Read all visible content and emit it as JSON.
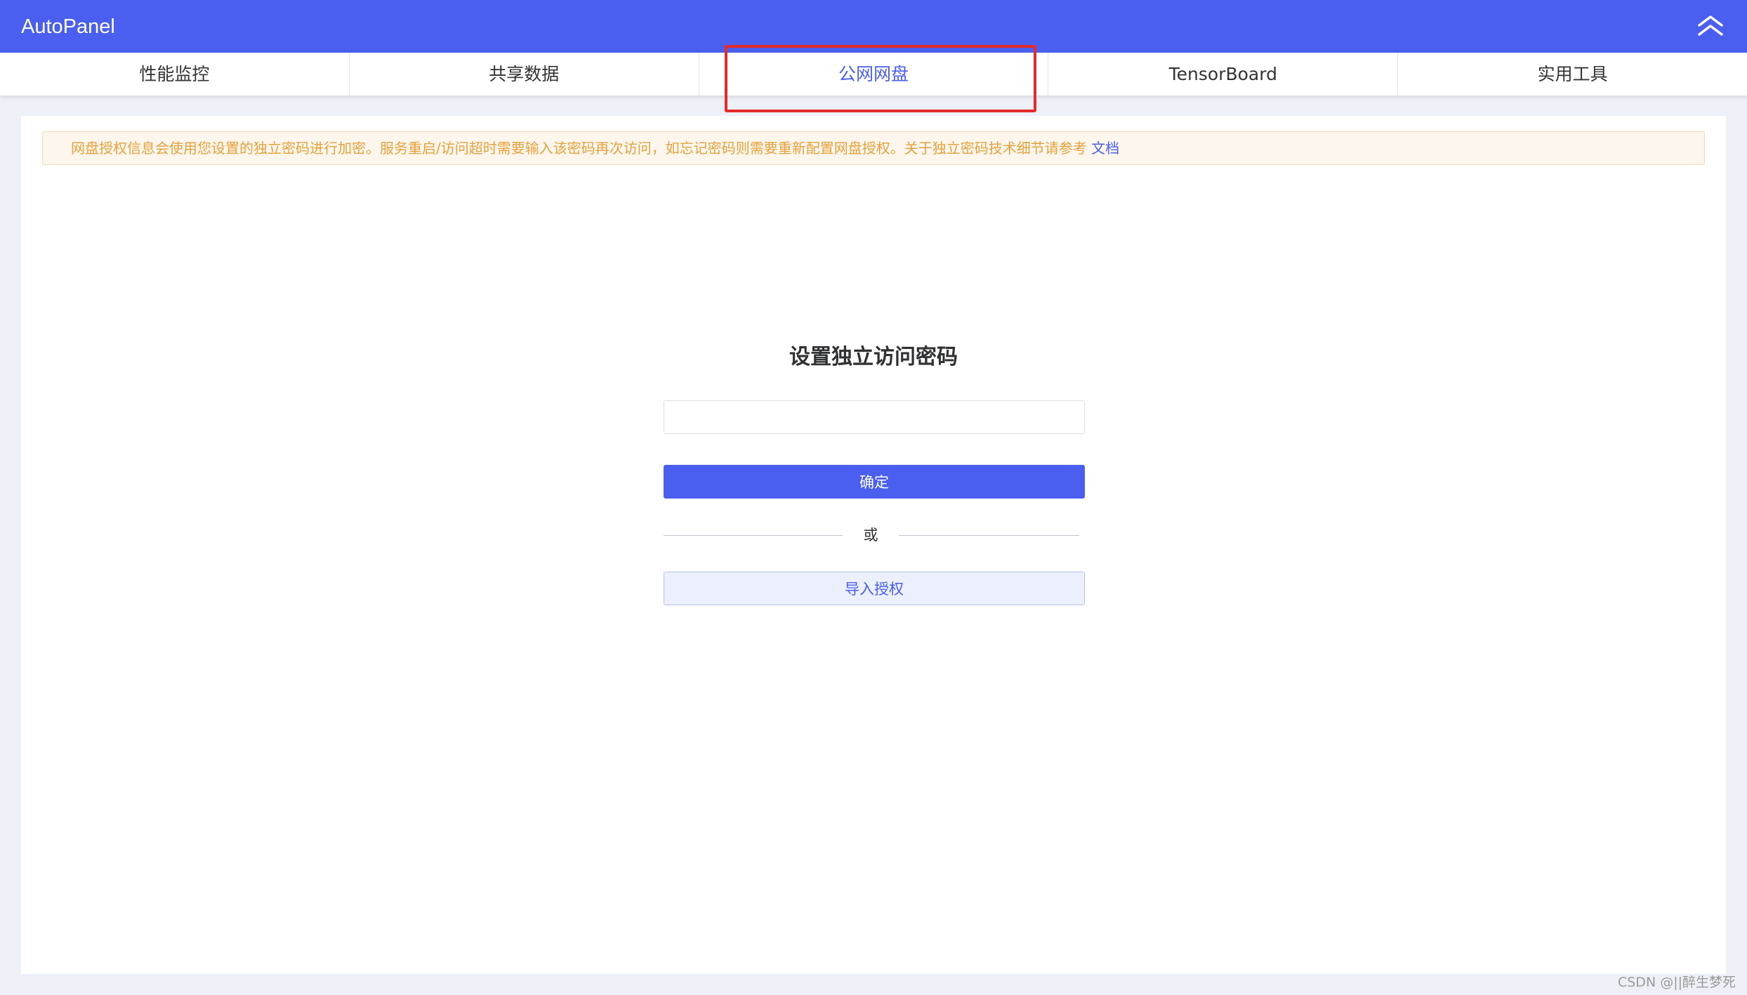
{
  "app": {
    "title": "AutoPanel"
  },
  "tabs": [
    {
      "label": "性能监控",
      "active": false
    },
    {
      "label": "共享数据",
      "active": false
    },
    {
      "label": "公网网盘",
      "active": true
    },
    {
      "label": "TensorBoard",
      "active": false
    },
    {
      "label": "实用工具",
      "active": false
    }
  ],
  "notice": {
    "text": "网盘授权信息会使用您设置的独立密码进行加密。服务重启/访问超时需要输入该密码再次访问，如忘记密码则需要重新配置网盘授权。关于独立密码技术细节请参考 ",
    "link_label": "文档"
  },
  "form": {
    "title": "设置独立访问密码",
    "password_value": "",
    "password_placeholder": "",
    "confirm_label": "确定",
    "divider_label": "或",
    "import_label": "导入授权"
  },
  "watermark": "CSDN @||醉生梦死",
  "colors": {
    "accent": "#4a5ff0",
    "warning_text": "#e6a23c",
    "warning_bg": "#fdf6ec",
    "highlight": "#e52a2a"
  },
  "icons": {
    "collapse": "double-chevron-up-icon"
  }
}
